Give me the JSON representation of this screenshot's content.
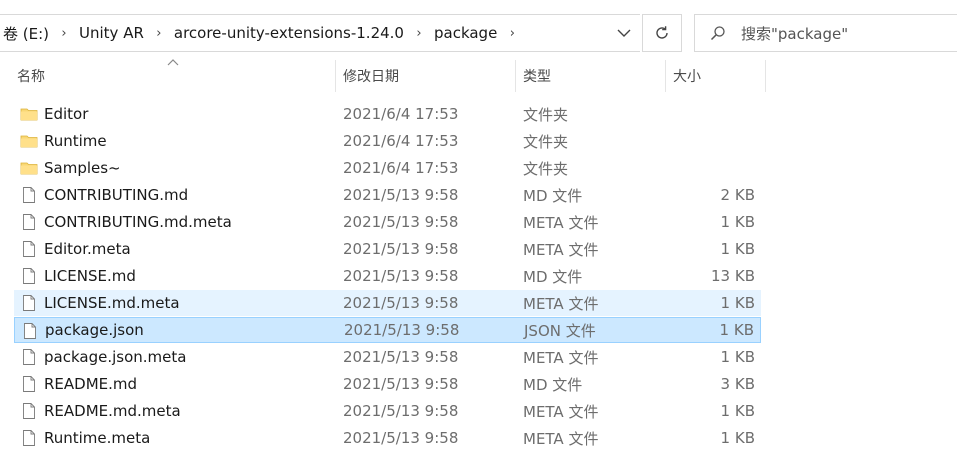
{
  "address": {
    "crumbs": [
      "卷 (E:)",
      "Unity AR",
      "arcore-unity-extensions-1.24.0",
      "package"
    ]
  },
  "search": {
    "placeholder": "搜索\"package\""
  },
  "icons": {
    "dropdown": "chevron-down-icon",
    "refresh": "refresh-icon",
    "search": "search-icon",
    "folder": "folder-icon",
    "file": "file-icon"
  },
  "columns": {
    "name": "名称",
    "date": "修改日期",
    "type": "类型",
    "size": "大小"
  },
  "files": [
    {
      "name": "Editor",
      "date": "2021/6/4 17:53",
      "type": "文件夹",
      "size": "",
      "kind": "folder"
    },
    {
      "name": "Runtime",
      "date": "2021/6/4 17:53",
      "type": "文件夹",
      "size": "",
      "kind": "folder"
    },
    {
      "name": "Samples~",
      "date": "2021/6/4 17:53",
      "type": "文件夹",
      "size": "",
      "kind": "folder"
    },
    {
      "name": "CONTRIBUTING.md",
      "date": "2021/5/13 9:58",
      "type": "MD 文件",
      "size": "2 KB",
      "kind": "file"
    },
    {
      "name": "CONTRIBUTING.md.meta",
      "date": "2021/5/13 9:58",
      "type": "META 文件",
      "size": "1 KB",
      "kind": "file"
    },
    {
      "name": "Editor.meta",
      "date": "2021/5/13 9:58",
      "type": "META 文件",
      "size": "1 KB",
      "kind": "file"
    },
    {
      "name": "LICENSE.md",
      "date": "2021/5/13 9:58",
      "type": "MD 文件",
      "size": "13 KB",
      "kind": "file"
    },
    {
      "name": "LICENSE.md.meta",
      "date": "2021/5/13 9:58",
      "type": "META 文件",
      "size": "1 KB",
      "kind": "file",
      "state": "hover"
    },
    {
      "name": "package.json",
      "date": "2021/5/13 9:58",
      "type": "JSON 文件",
      "size": "1 KB",
      "kind": "file",
      "state": "selected"
    },
    {
      "name": "package.json.meta",
      "date": "2021/5/13 9:58",
      "type": "META 文件",
      "size": "1 KB",
      "kind": "file"
    },
    {
      "name": "README.md",
      "date": "2021/5/13 9:58",
      "type": "MD 文件",
      "size": "3 KB",
      "kind": "file"
    },
    {
      "name": "README.md.meta",
      "date": "2021/5/13 9:58",
      "type": "META 文件",
      "size": "1 KB",
      "kind": "file"
    },
    {
      "name": "Runtime.meta",
      "date": "2021/5/13 9:58",
      "type": "META 文件",
      "size": "1 KB",
      "kind": "file"
    }
  ],
  "colors": {
    "hover": "#e5f3ff",
    "selected": "#cce8ff",
    "selected_border": "#99d1ff",
    "folder": "#f8d775"
  }
}
